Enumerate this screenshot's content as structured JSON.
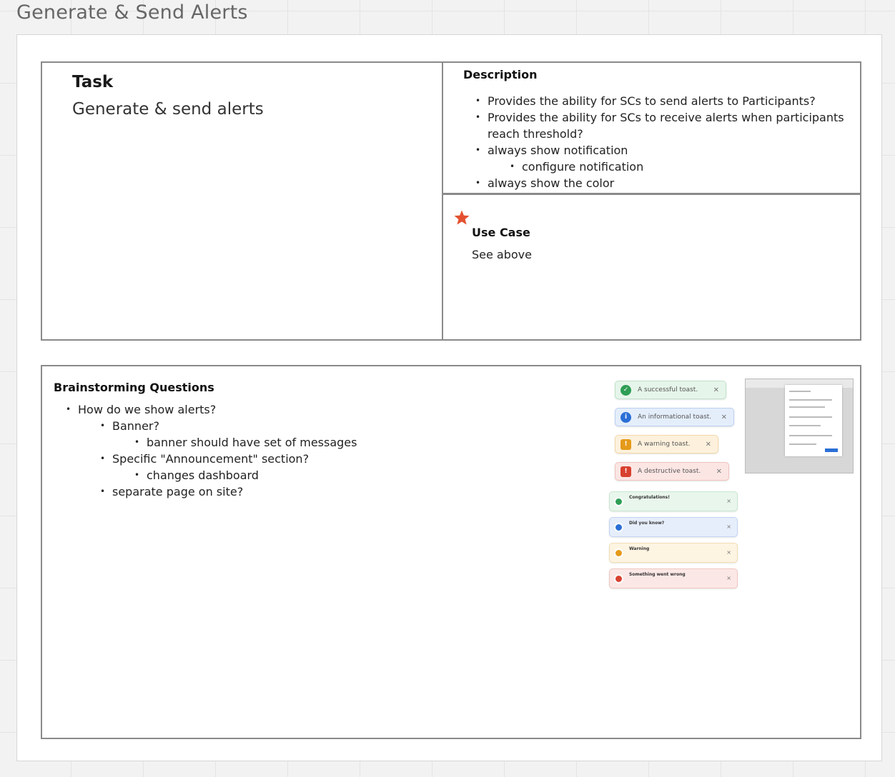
{
  "frame": {
    "title": "Generate & Send Alerts"
  },
  "task": {
    "label": "Task",
    "value": "Generate & send alerts"
  },
  "description": {
    "title": "Description",
    "items": [
      {
        "text": "Provides the ability for SCs to send alerts to Participants?",
        "level": 1
      },
      {
        "text": "Provides the ability for SCs to receive alerts when participants reach threshold?",
        "level": 1
      },
      {
        "text": "always show notification",
        "level": 1
      },
      {
        "text": "configure notification",
        "level": 2
      },
      {
        "text": "always show the color",
        "level": 1
      }
    ]
  },
  "use_case": {
    "title": "Use Case",
    "text": "See above",
    "icon": "star-icon",
    "icon_color": "#e4502f"
  },
  "brainstorming": {
    "title": "Brainstorming Questions",
    "items": [
      {
        "text": "How do we show alerts?",
        "level": 1
      },
      {
        "text": "Banner?",
        "level": 2
      },
      {
        "text": "banner should have set of messages",
        "level": 3
      },
      {
        "text": "Specific \"Announcement\" section?",
        "level": 2
      },
      {
        "text": "changes dashboard",
        "level": 3
      },
      {
        "text": "separate page on site?",
        "level": 2
      }
    ]
  },
  "toast_examples": {
    "simple": [
      {
        "text": "A successful toast.",
        "icon": "check-icon",
        "variant": "success"
      },
      {
        "text": "An informational toast.",
        "icon": "info-icon",
        "variant": "info"
      },
      {
        "text": "A warning toast.",
        "icon": "warning-icon",
        "variant": "warning"
      },
      {
        "text": "A destructive toast.",
        "icon": "warning-icon",
        "variant": "danger"
      }
    ],
    "detailed": [
      {
        "title": "Congratulations!",
        "variant": "success"
      },
      {
        "title": "Did you know?",
        "variant": "info"
      },
      {
        "title": "Warning",
        "variant": "warning"
      },
      {
        "title": "Something went wrong",
        "variant": "danger"
      }
    ],
    "close_glyph": "×"
  },
  "colors": {
    "success": "#2e9e55",
    "info": "#2b6fd6",
    "warning": "#e59a1a",
    "danger": "#d8402f"
  }
}
